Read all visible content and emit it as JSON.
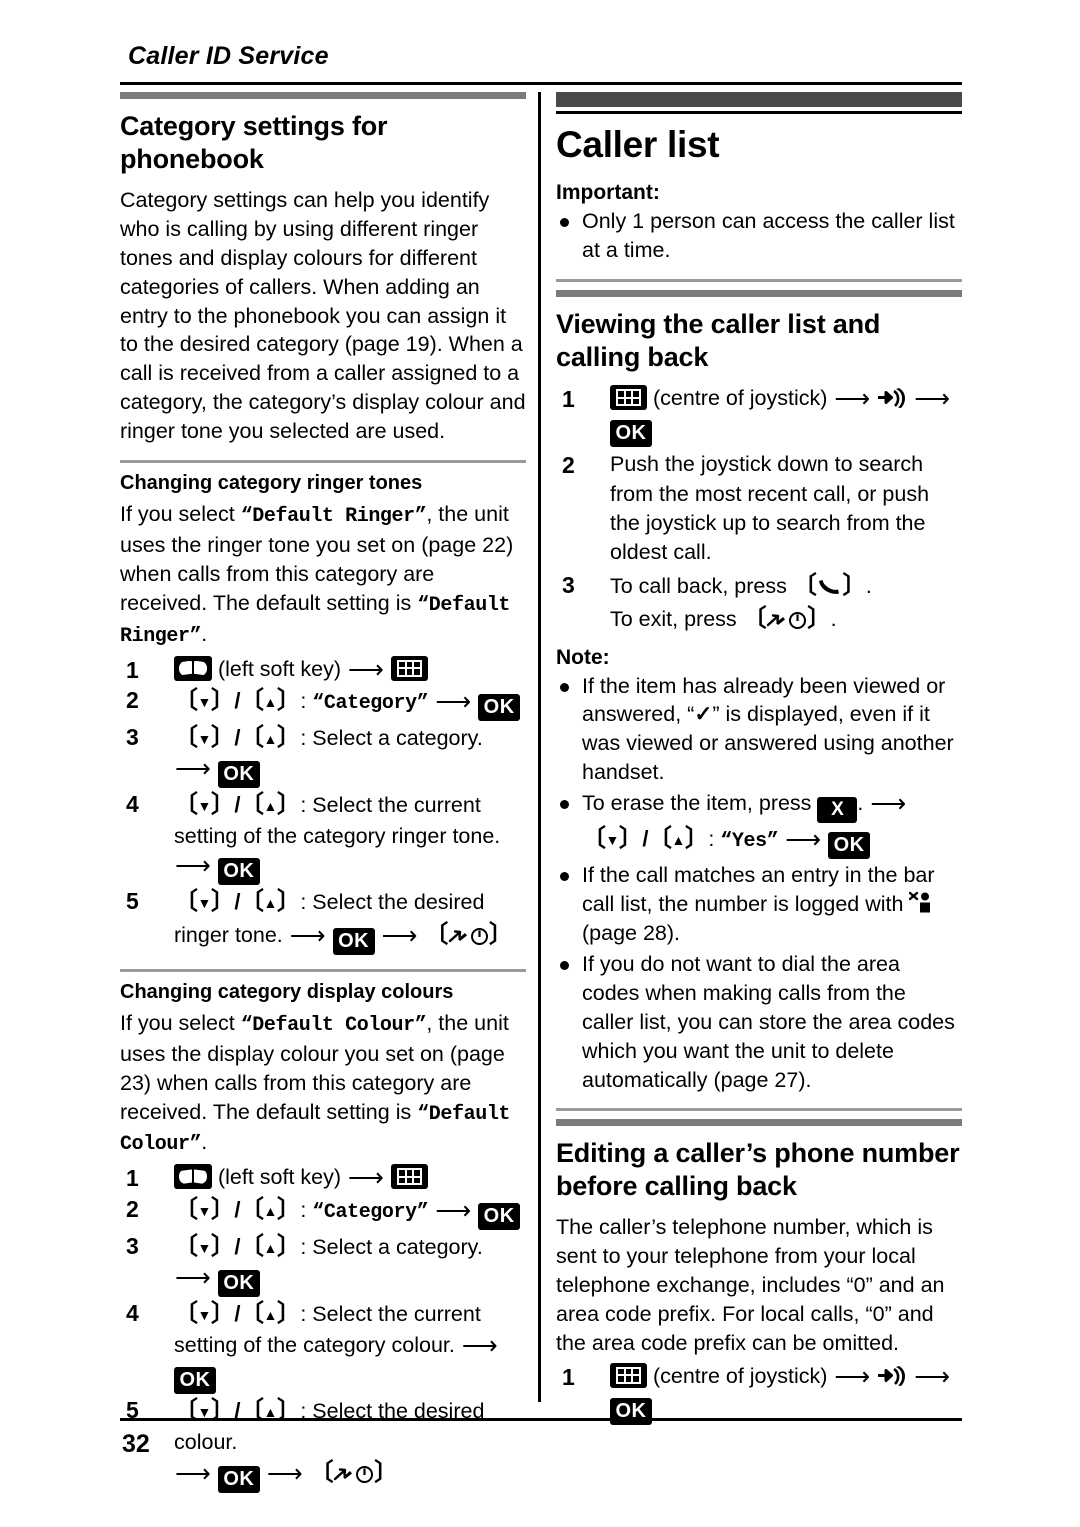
{
  "running_header": "Caller ID Service",
  "page_number": "32",
  "icons": {
    "phonebook_key": "phonebook-book-icon",
    "joystick_centre": "joystick-centre-grid-icon",
    "ok": "OK",
    "erase": "X",
    "incoming_call": "incoming-call-handset-icon",
    "talk": "talk-handset-icon",
    "off": "power-off-icon",
    "bar_call": "barred-caller-icon",
    "check": "✓",
    "arrow": "→"
  },
  "left_column": {
    "section1": {
      "heading": "Category settings for phonebook",
      "intro": "Category settings can help you identify who is calling by using different ringer tones and display colours for different categories of callers. When adding an entry to the phonebook you can assign it to the desired category (page 19). When a call is received from a caller assigned to a category, the category’s display colour and ringer tone you selected are used.",
      "sub1": {
        "heading": "Changing category ringer tones",
        "intro_a": "If you select ",
        "intro_mono1": "“Default Ringer”",
        "intro_b": ", the unit uses the ringer tone you set on (page 22) when calls from this category are received. The default setting is ",
        "intro_mono2": "“Default Ringer”",
        "intro_c": ".",
        "steps": [
          {
            "n": "1",
            "text_a": "(left soft key)"
          },
          {
            "n": "2",
            "label": "“Category”"
          },
          {
            "n": "3",
            "label": "Select a category."
          },
          {
            "n": "4",
            "label": "Select the current setting of the category ringer tone."
          },
          {
            "n": "5",
            "label": "Select the desired ringer tone."
          }
        ]
      },
      "sub2": {
        "heading": "Changing category display colours",
        "intro_a": "If you select ",
        "intro_mono1": "“Default Colour”",
        "intro_b": ", the unit uses the display colour you set on (page 23) when calls from this category are received. The default setting is ",
        "intro_mono2": "“Default Colour”",
        "intro_c": ".",
        "steps": [
          {
            "n": "1",
            "text_a": "(left soft key)"
          },
          {
            "n": "2",
            "label": "“Category”"
          },
          {
            "n": "3",
            "label": "Select a category."
          },
          {
            "n": "4",
            "label": "Select the current setting of the category colour."
          },
          {
            "n": "5",
            "label": "Select the desired colour."
          }
        ]
      }
    }
  },
  "right_column": {
    "chapter_heading": "Caller list",
    "important": {
      "label": "Important:",
      "items": [
        "Only 1 person can access the caller list at a time."
      ]
    },
    "section_viewing": {
      "heading": "Viewing the caller list and calling back",
      "step1_text": "(centre of joystick)",
      "step2": "Push the joystick down to search from the most recent call, or push the joystick up to search from the oldest call.",
      "step3_line1_a": "To call back, press ",
      "step3_line1_b": ".",
      "step3_line2_a": "To exit, press ",
      "step3_line2_b": "."
    },
    "note": {
      "label": "Note:",
      "item1_a": "If the item has already been viewed or answered, “",
      "item1_check": "✓",
      "item1_b": "” is displayed, even if it was viewed or answered using another handset.",
      "item2_a": "To erase the item, press ",
      "item2_b": ". ",
      "item2_yes": "“Yes”",
      "item3_a": "If the call matches an entry in the bar call list, the number is logged with ",
      "item3_b": " (page 28).",
      "item4": "If you do not want to dial the area codes when making calls from the caller list, you can store the area codes which you want the unit to delete automatically (page 27)."
    },
    "section_editing": {
      "heading": "Editing a caller’s phone number before calling back",
      "intro": "The caller’s telephone number, which is sent to your telephone from your local telephone exchange, includes “0” and an area code prefix. For local calls, “0” and the area code prefix can be omitted.",
      "step1_text": "(centre of joystick)"
    }
  }
}
